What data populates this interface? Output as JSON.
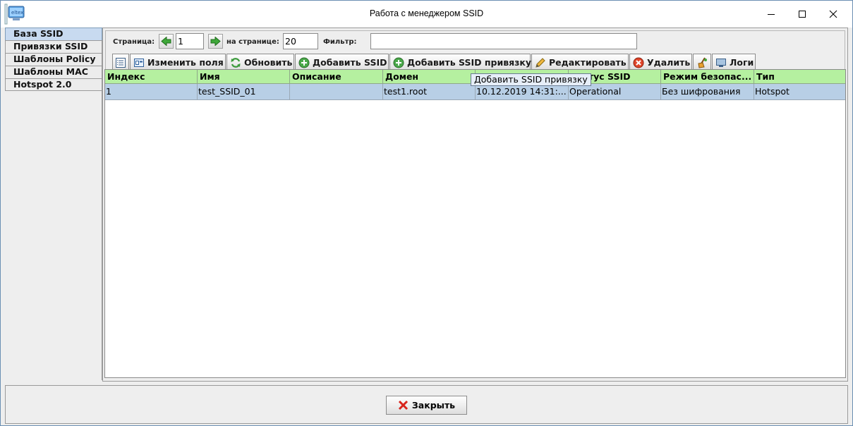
{
  "window": {
    "title": "Работа с менеджером SSID",
    "app_icon_text": "eltex"
  },
  "sidebar": {
    "items": [
      {
        "label": "База SSID",
        "active": true
      },
      {
        "label": "Привязки SSID",
        "active": false
      },
      {
        "label": "Шаблоны Policy",
        "active": false
      },
      {
        "label": "Шаблоны MAC",
        "active": false
      },
      {
        "label": "Hotspot 2.0",
        "active": false
      }
    ]
  },
  "pager": {
    "page_label": "Страница:",
    "page_value": "1",
    "per_page_label": "на странице:",
    "per_page_value": "20",
    "filter_label": "Фильтр:",
    "filter_value": ""
  },
  "toolbar": {
    "columns_icon": "column-list-icon",
    "change_fields": "Изменить поля",
    "refresh": "Обновить",
    "add_ssid": "Добавить SSID",
    "add_binding": "Добавить SSID привязку",
    "edit": "Редактировать",
    "delete": "Удалить",
    "clean_icon": "broom-icon",
    "logs": "Логи"
  },
  "tooltip": "Добавить SSID привязку",
  "table": {
    "columns": [
      "Индекс",
      "Имя",
      "Описание",
      "Домен",
      "",
      "Статус SSID",
      "Режим безопас...",
      "Тип"
    ],
    "rows": [
      [
        "1",
        "test_SSID_01",
        "",
        "test1.root",
        "10.12.2019 14:31:...",
        "Operational",
        "Без шифрования",
        "Hotspot"
      ]
    ]
  },
  "footer": {
    "close": "Закрыть"
  },
  "colors": {
    "header_green": "#b5f0a0",
    "selected_row": "#b8cfe6",
    "active_tab": "#c8daf0"
  }
}
